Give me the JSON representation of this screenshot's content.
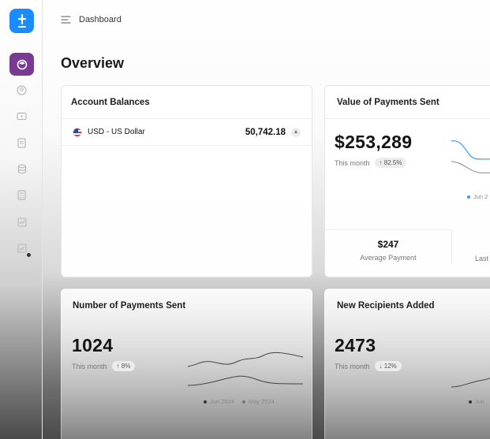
{
  "header": {
    "title": "Dashboard"
  },
  "page": {
    "title": "Overview"
  },
  "colors": {
    "accent": "#1a8cff",
    "active_nav": "#7a3a91",
    "chart_line": "#3a9be6"
  },
  "sidebar": {
    "items": [
      {
        "icon": "dashboard-icon",
        "active": true
      },
      {
        "icon": "user-circle-icon"
      },
      {
        "icon": "wallet-icon"
      },
      {
        "icon": "document-icon"
      },
      {
        "icon": "database-icon"
      },
      {
        "icon": "calculator-icon"
      },
      {
        "icon": "chart-icon"
      },
      {
        "icon": "checklist-icon"
      }
    ]
  },
  "balances": {
    "title": "Account Balances",
    "rows": [
      {
        "currency": "USD - US Dollar",
        "amount": "50,742.18"
      }
    ]
  },
  "value_sent": {
    "title": "Value of Payments Sent",
    "value": "$253,289",
    "period": "This month",
    "change": "↑ 82.5%",
    "legend_current": "Jun 2",
    "avg_value": "$247",
    "avg_label": "Average Payment",
    "last_label": "Last"
  },
  "num_sent": {
    "title": "Number of Payments Sent",
    "value": "1024",
    "period": "This month",
    "change": "↑ 8%",
    "legend_current": "Jun 2024",
    "legend_previous": "May 2024"
  },
  "recipients": {
    "title": "New Recipients Added",
    "value": "2473",
    "period": "This month",
    "change": "↓ 12%",
    "legend_current": "Jun"
  }
}
